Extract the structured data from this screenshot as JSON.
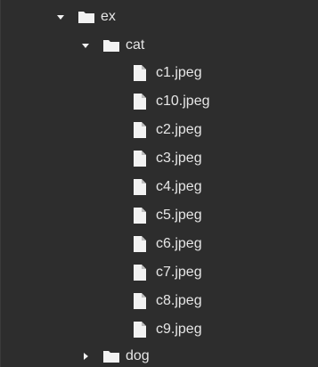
{
  "tree": {
    "root": {
      "label": "ex",
      "expanded": true,
      "icon": "folder-icon",
      "children": [
        {
          "label": "cat",
          "expanded": true,
          "icon": "folder-icon",
          "files": [
            "c1.jpeg",
            "c10.jpeg",
            "c2.jpeg",
            "c3.jpeg",
            "c4.jpeg",
            "c5.jpeg",
            "c6.jpeg",
            "c7.jpeg",
            "c8.jpeg",
            "c9.jpeg"
          ]
        },
        {
          "label": "dog",
          "expanded": false,
          "icon": "folder-icon"
        }
      ]
    }
  },
  "colors": {
    "background": "#2d2d2d",
    "text": "#e6e6e6",
    "icon": "#f2f2f2"
  }
}
